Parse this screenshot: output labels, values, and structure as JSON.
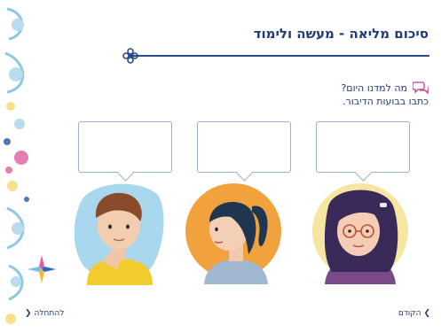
{
  "page": {
    "title": "סיכום מליאה - מעשה ולימוד",
    "question": "מה למדנו היום?",
    "instruction": "כתבו בבועות הדיבור.",
    "chat_icon": "chat-bubbles-icon"
  },
  "bubbles": [
    {
      "value": "",
      "character": "boy"
    },
    {
      "value": "",
      "character": "girl-ponytail"
    },
    {
      "value": "",
      "character": "girl-glasses"
    }
  ],
  "nav": {
    "start_label": "להתחלה",
    "prev_label": "הקודם"
  },
  "colors": {
    "accent": "#233a78",
    "boy_bg": "#a9d8ee",
    "ponytail_bg": "#f2a23c",
    "glasses_bg": "#f6e6a2"
  }
}
